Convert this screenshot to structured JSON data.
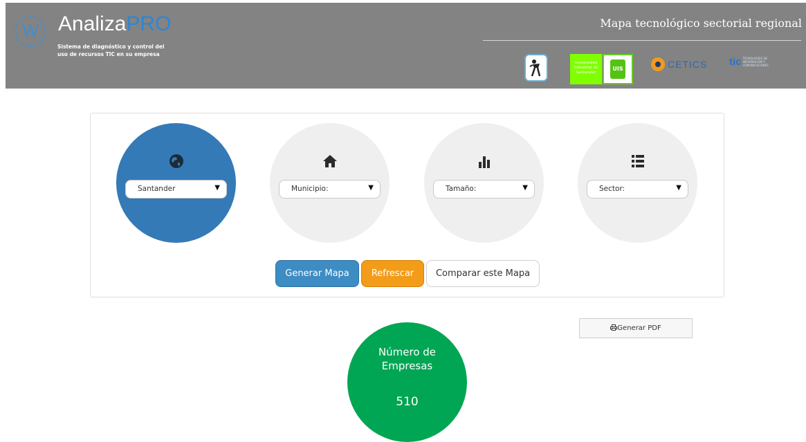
{
  "header": {
    "logo_letter": "W",
    "brand_main": "Analiza",
    "brand_accent": "PRO",
    "tagline_line1": "Sistema de diagnóstico y control del",
    "tagline_line2": "uso de recursos TIC en su empresa",
    "title": "Mapa tecnológico sectorial regional",
    "partners": {
      "uis_text": "Universidad Industrial de Santander",
      "uis_mark": "UIS",
      "cetics": "CETICS",
      "tic_mark": "tic",
      "tic_text": "TECNOLOGÍAS DE INFORMACIÓN Y COMUNICACIONES"
    }
  },
  "filters": [
    {
      "key": "region",
      "icon": "globe-icon",
      "value": "Santander",
      "active": true
    },
    {
      "key": "municipio",
      "icon": "home-icon",
      "value": "Municipio:",
      "active": false
    },
    {
      "key": "tamano",
      "icon": "bar-chart-icon",
      "value": "Tamaño:",
      "active": false
    },
    {
      "key": "sector",
      "icon": "list-icon",
      "value": "Sector:",
      "active": false
    }
  ],
  "dropdown_arrow": "▼",
  "actions": {
    "generate_map": "Generar Mapa",
    "refresh": "Refrescar",
    "compare": "Comparar este Mapa"
  },
  "pdf": {
    "icon": "printer-icon",
    "label": "Generar PDF"
  },
  "stats": {
    "label_line1": "Número de",
    "label_line2": "Empresas",
    "value": "510"
  },
  "colors": {
    "header_bg": "#838383",
    "accent_blue": "#337ab7",
    "refresh_orange": "#f39c1a",
    "stat_green": "#00a653"
  }
}
